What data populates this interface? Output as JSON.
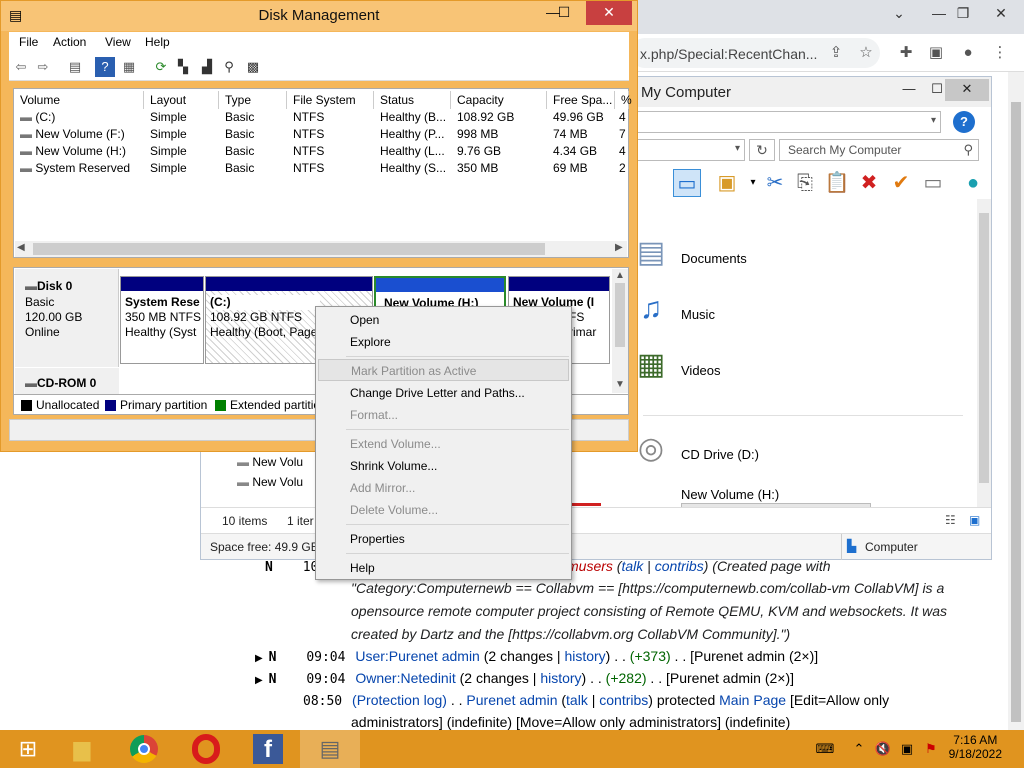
{
  "browser": {
    "url_partial": "x.php/Special:RecentChan...",
    "wiki": {
      "line1_partial": "musers",
      "line1_talk": "talk",
      "line1_contribs": "contribs",
      "line1_rest": "(Created page with",
      "line2": "\"Category:Computernewb == Collabvm == [https://computernewb.com/collab-vm CollabVM] is a",
      "line3": "opensource remote computer project consisting of Remote QEMU, KVM and websockets. It was",
      "line4": "created by Dartz and the [https://collabvm.org CollabVM Community].\")",
      "rows": [
        {
          "flag": "N",
          "time": "09:04",
          "page": "User:Purenet admin",
          "changes": "(2 changes | ",
          "hist": "history",
          "sep": ") . . ",
          "diff": "(+373)",
          "user": " . . [Purenet admin (2×)]"
        },
        {
          "flag": "N",
          "time": "09:04",
          "page": "Owner:Netedinit",
          "changes": "(2 changes | ",
          "hist": "history",
          "sep": ") . . ",
          "diff": "(+282)",
          "user": " . . [Purenet admin (2×)]"
        }
      ],
      "log_time": "08:50",
      "log_text1": "(Protection log)",
      "log_text2": " . . ",
      "log_user": "Purenet admin",
      "log_talk": "talk",
      "log_contribs": "contribs",
      "log_action": " protected ",
      "log_page": "Main Page",
      "log_rest": " [Edit=Allow only",
      "log_line2": "administrators] (indefinite) [Move=Allow only administrators] (indefinite)",
      "partial_flag": "N",
      "partial_num": "10"
    }
  },
  "mycomputer": {
    "title": "My Computer",
    "search_placeholder": "Search My Computer",
    "items": [
      {
        "label": "Documents"
      },
      {
        "label": "Music"
      },
      {
        "label": "Videos"
      },
      {
        "label": "CD Drive (D:)"
      },
      {
        "label": "New Volume (H:)"
      }
    ],
    "side_items": [
      "New Volu",
      "New Volu"
    ],
    "status_count": "10 items",
    "status_sel": "1 iter",
    "space_free": "Space free: 49.9 GB,",
    "computer_label": "Computer"
  },
  "diskmgmt": {
    "title": "Disk Management",
    "menu": [
      "File",
      "Action",
      "View",
      "Help"
    ],
    "columns": [
      "Volume",
      "Layout",
      "Type",
      "File System",
      "Status",
      "Capacity",
      "Free Spa...",
      "%"
    ],
    "rows": [
      [
        "(C:)",
        "Simple",
        "Basic",
        "NTFS",
        "Healthy (B...",
        "108.92 GB",
        "49.96 GB",
        "4"
      ],
      [
        "New Volume (F:)",
        "Simple",
        "Basic",
        "NTFS",
        "Healthy (P...",
        "998 MB",
        "74 MB",
        "7"
      ],
      [
        "New Volume (H:)",
        "Simple",
        "Basic",
        "NTFS",
        "Healthy (L...",
        "9.76 GB",
        "4.34 GB",
        "4"
      ],
      [
        "System Reserved",
        "Simple",
        "Basic",
        "NTFS",
        "Healthy (S...",
        "350 MB",
        "69 MB",
        "2"
      ]
    ],
    "disk0": {
      "name": "Disk 0",
      "type": "Basic",
      "size": "120.00 GB",
      "state": "Online"
    },
    "partitions": [
      {
        "name": "System Rese",
        "size": "350 MB NTFS",
        "status": "Healthy (Syst"
      },
      {
        "name": "(C:)",
        "size": "108.92 GB NTFS",
        "status": "Healthy (Boot, Page"
      },
      {
        "name": "New Volume (H:)",
        "size": "",
        "status": ""
      },
      {
        "name": "New Volume (I",
        "size": "FS",
        "status": "rimar"
      }
    ],
    "cdrom": "CD-ROM 0",
    "legend": [
      "Unallocated",
      "Primary partition",
      "Extended partitio"
    ],
    "colors": {
      "unallocated": "#000000",
      "primary": "#00007f",
      "extended": "#008000"
    }
  },
  "context_menu": {
    "items": [
      {
        "label": "Open",
        "disabled": false
      },
      {
        "label": "Explore",
        "disabled": false
      },
      {
        "label": "Mark Partition as Active",
        "disabled": true
      },
      {
        "label": "Change Drive Letter and Paths...",
        "disabled": false
      },
      {
        "label": "Format...",
        "disabled": true
      },
      {
        "label": "Extend Volume...",
        "disabled": true
      },
      {
        "label": "Shrink Volume...",
        "disabled": false
      },
      {
        "label": "Add Mirror...",
        "disabled": true
      },
      {
        "label": "Delete Volume...",
        "disabled": true
      },
      {
        "label": "Properties",
        "disabled": false
      },
      {
        "label": "Help",
        "disabled": false
      }
    ]
  },
  "taskbar": {
    "time": "7:16 AM",
    "date": "9/18/2022"
  }
}
